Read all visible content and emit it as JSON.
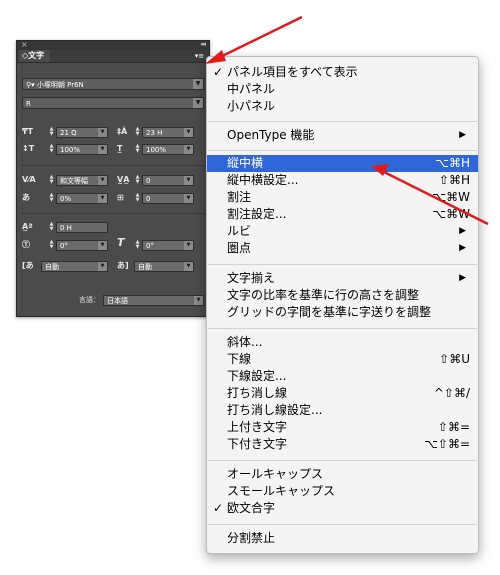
{
  "panel": {
    "close": "×",
    "collapse": "◂◂",
    "tab": "◇文字",
    "menu_button": "▾≡",
    "font_family": "小塚明朝 Pr6N",
    "font_style": "R",
    "font_size": "21 Q",
    "leading": "23 H",
    "vertical_scale": "100%",
    "horizontal_scale": "100%",
    "kerning": "和文等幅",
    "tracking": "0",
    "tsume": "0%",
    "aki": "0",
    "baseline_shift": "0 H",
    "rotation": "0°",
    "skew": "0°",
    "mojigumi_before": "自動",
    "mojigumi_after": "自動",
    "language_label": "言語：",
    "language": "日本語"
  },
  "menu": {
    "items": [
      {
        "label": "パネル項目をすべて表示",
        "check": "✓"
      },
      {
        "label": "中パネル"
      },
      {
        "label": "小パネル"
      },
      {
        "label": "OpenType 機能",
        "sub": "▶"
      },
      {
        "label": "縦中横",
        "shortcut": "⌥⌘H"
      },
      {
        "label": "縦中横設定...",
        "shortcut": "⇧⌘H"
      },
      {
        "label": "割注",
        "shortcut": "⌥⌘W"
      },
      {
        "label": "割注設定...",
        "shortcut": "⌥⌘W"
      },
      {
        "label": "ルビ",
        "sub": "▶"
      },
      {
        "label": "圏点",
        "sub": "▶"
      },
      {
        "label": "文字揃え",
        "sub": "▶"
      },
      {
        "label": "文字の比率を基準に行の高さを調整"
      },
      {
        "label": "グリッドの字間を基準に字送りを調整"
      },
      {
        "label": "斜体..."
      },
      {
        "label": "下線",
        "shortcut": "⇧⌘U"
      },
      {
        "label": "下線設定..."
      },
      {
        "label": "打ち消し線",
        "shortcut": "^⇧⌘/"
      },
      {
        "label": "打ち消し線設定..."
      },
      {
        "label": "上付き文字",
        "shortcut": "⇧⌘="
      },
      {
        "label": "下付き文字",
        "shortcut": "⌥⇧⌘="
      },
      {
        "label": "オールキャップス"
      },
      {
        "label": "スモールキャップス"
      },
      {
        "label": "欧文合字",
        "check": "✓"
      },
      {
        "label": "分割禁止"
      }
    ]
  },
  "annotation": {
    "color": "#e01b1b"
  }
}
